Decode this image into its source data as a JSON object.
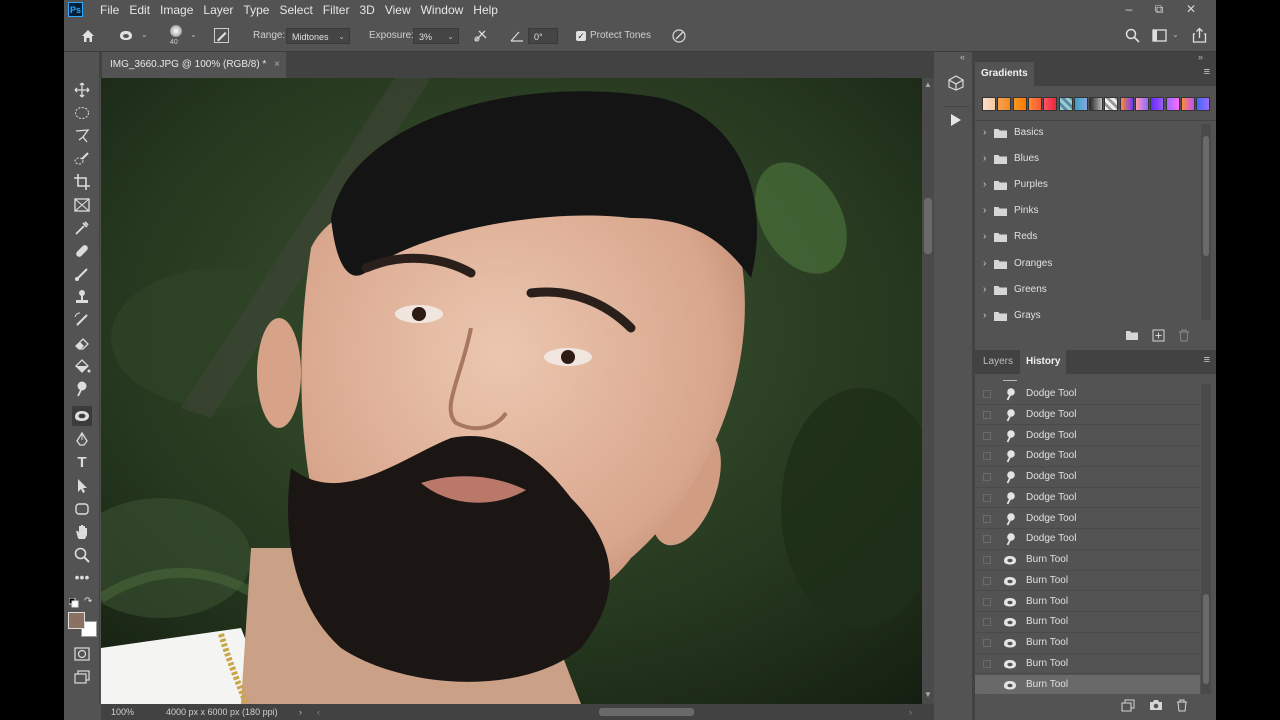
{
  "menu": [
    "File",
    "Edit",
    "Image",
    "Layer",
    "Type",
    "Select",
    "Filter",
    "3D",
    "View",
    "Window",
    "Help"
  ],
  "app_logo": "Ps",
  "options": {
    "brush_size": "40",
    "range_label": "Range:",
    "range_value": "Midtones",
    "exposure_label": "Exposure:",
    "exposure_value": "3%",
    "angle_value": "0°",
    "protect_tones_label": "Protect Tones",
    "protect_tones_checked": true
  },
  "document": {
    "tab_title": "IMG_3660.JPG @ 100% (RGB/8) *",
    "zoom": "100%",
    "dimensions": "4000 px x 6000 px (180 ppi)"
  },
  "colors": {
    "foreground": "#8a7162",
    "background": "#ffffff",
    "accent": "#31a8ff"
  },
  "gradients_panel": {
    "title": "Gradients",
    "presets": [
      {
        "name": "Basics"
      },
      {
        "name": "Blues"
      },
      {
        "name": "Purples"
      },
      {
        "name": "Pinks"
      },
      {
        "name": "Reds"
      },
      {
        "name": "Oranges"
      },
      {
        "name": "Greens"
      },
      {
        "name": "Grays"
      }
    ]
  },
  "history_panel": {
    "tabs": [
      "Layers",
      "History"
    ],
    "active_tab": "History",
    "items": [
      {
        "label": "Dodge Tool",
        "icon": "dodge-icon"
      },
      {
        "label": "Dodge Tool",
        "icon": "dodge-icon"
      },
      {
        "label": "Dodge Tool",
        "icon": "dodge-icon"
      },
      {
        "label": "Dodge Tool",
        "icon": "dodge-icon"
      },
      {
        "label": "Dodge Tool",
        "icon": "dodge-icon"
      },
      {
        "label": "Dodge Tool",
        "icon": "dodge-icon"
      },
      {
        "label": "Dodge Tool",
        "icon": "dodge-icon"
      },
      {
        "label": "Dodge Tool",
        "icon": "dodge-icon"
      },
      {
        "label": "Burn Tool",
        "icon": "burn-icon"
      },
      {
        "label": "Burn Tool",
        "icon": "burn-icon"
      },
      {
        "label": "Burn Tool",
        "icon": "burn-icon"
      },
      {
        "label": "Burn Tool",
        "icon": "burn-icon"
      },
      {
        "label": "Burn Tool",
        "icon": "burn-icon"
      },
      {
        "label": "Burn Tool",
        "icon": "burn-icon"
      },
      {
        "label": "Burn Tool",
        "icon": "burn-icon",
        "selected": true
      }
    ]
  },
  "tools": [
    "move-tool",
    "marquee-tool",
    "lasso-tool",
    "quick-select-tool",
    "crop-tool",
    "frame-tool",
    "eyedropper-tool",
    "healing-tool",
    "brush-tool",
    "stamp-tool",
    "history-brush-tool",
    "eraser-tool",
    "paint-bucket-tool",
    "dodge-tool",
    "burn-tool",
    "pen-tool",
    "type-tool",
    "path-select-tool",
    "shape-tool",
    "hand-tool",
    "zoom-tool",
    "more-tools"
  ]
}
